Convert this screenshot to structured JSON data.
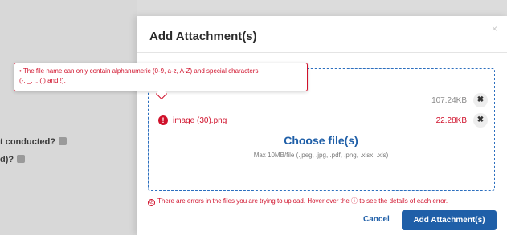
{
  "background": {
    "question_1": "t conducted?",
    "question_2": "d)?"
  },
  "modal": {
    "title": "Add Attachment(s)",
    "close_icon": "×"
  },
  "files": [
    {
      "name": "",
      "size": "107.24KB",
      "size_status": "ok"
    },
    {
      "name": "image (30).png",
      "size": "22.28KB",
      "size_status": "error"
    }
  ],
  "remove_icon": "✖",
  "dropzone": {
    "choose_label": "Choose file(s)",
    "max_text": "Max 10MB/file (.jpeg, .jpg, .pdf, .png, .xlsx, .xls)"
  },
  "error_message": "There are errors in the files you are trying to upload. Hover over the ⓘ to see the details of each error.",
  "tooltip": {
    "line1": "• The file name can only contain alphanumeric (0-9, a-z, A-Z) and special characters",
    "line2": "(-, _, ., ( ) and !)."
  },
  "buttons": {
    "cancel": "Cancel",
    "add": "Add Attachment(s)"
  },
  "colors": {
    "primary": "#1f5fa8",
    "error": "#d0112b",
    "dropzone_border": "#2c6fbf"
  },
  "icons": {
    "error": "error-circle-icon",
    "remove": "remove-x-icon",
    "help": "help-icon",
    "close": "close-icon"
  }
}
